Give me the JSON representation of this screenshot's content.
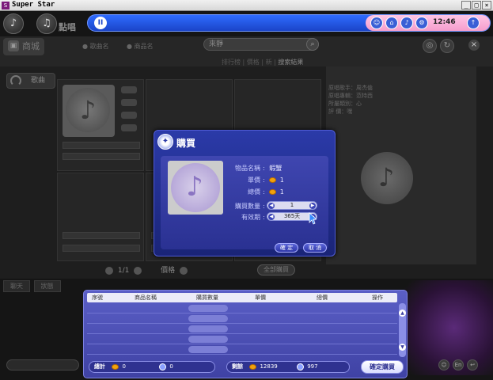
{
  "window": {
    "title": "Super Star",
    "buttons": [
      "_",
      "□",
      "×"
    ]
  },
  "topnav": {
    "music_label": "點唱",
    "clock": "12:46"
  },
  "store": {
    "tab_label": "商城",
    "radio_1": "歌曲名",
    "radio_2": "商品名",
    "search_placeholder": "來靜",
    "sort_labels": [
      "排行榜",
      "價格",
      "新",
      "搜索結果"
    ],
    "sidebar_song": "歌曲",
    "pager": "1/1",
    "pager_sort_label": "價格",
    "all_purchase": "全部購買",
    "info_lines": [
      "原唱歌手：周杰倫",
      "原唱專輯：范特西",
      "所屬類別：心",
      "評    價：嘿"
    ]
  },
  "dialog": {
    "title": "購買",
    "item_name_label": "物品名稱",
    "item_name": "蝦蟹",
    "unit_price_label": "單價",
    "unit_price": "1",
    "total_price_label": "總價",
    "total_price": "1",
    "quantity_label": "購買數量",
    "quantity": "1",
    "validity_label": "有效期",
    "validity": "365天",
    "ok_label": "確 定",
    "cancel_label": "取 消"
  },
  "cart": {
    "columns": [
      "序號",
      "商品名稱",
      "購買數量",
      "單價",
      "總價",
      "操作"
    ],
    "total_label": "總計",
    "total_coins": "0",
    "total_gems": "0",
    "remaining_label": "剩餘",
    "remaining_coins": "12839",
    "remaining_gems": "997",
    "confirm_label": "確定購買"
  },
  "lower": {
    "tabs": [
      "聊天",
      "狀態"
    ]
  },
  "colors": {
    "player_blue": "#1b44c8",
    "dialog_blue": "#2b3aa8",
    "pink": "#f59dcc",
    "coin_gold": "#f2a20b"
  },
  "icons": [
    "play-icon",
    "cart-icon",
    "search-icon",
    "headphones-icon",
    "gift-icon",
    "coin-icon",
    "gem-icon",
    "music-note-icon",
    "close-icon"
  ]
}
